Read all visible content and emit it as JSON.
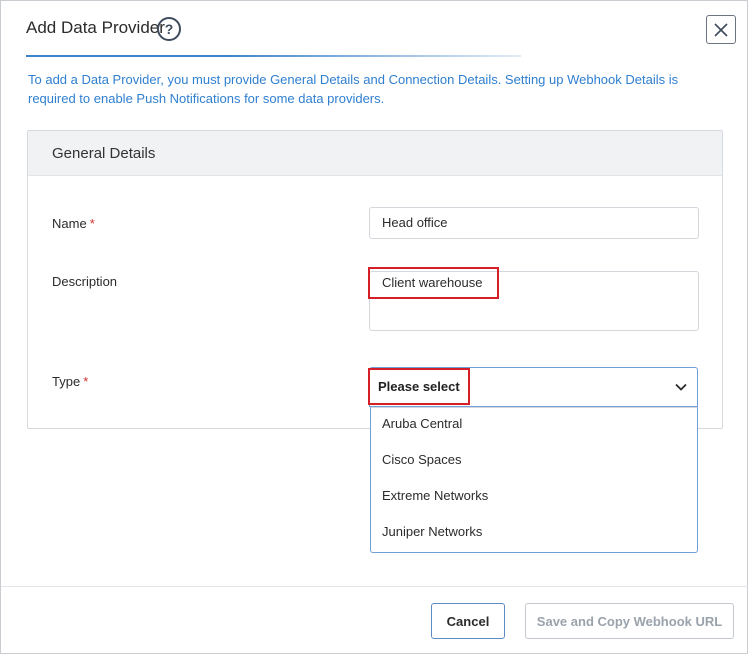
{
  "dialog": {
    "title": "Add Data Provider",
    "help_icon": "question-icon",
    "close_icon": "close-icon",
    "intro": "To add a Data Provider, you must provide General Details and Connection Details. Setting up Webhook Details is required to enable Push Notifications for some data providers."
  },
  "panel": {
    "header": "General Details",
    "fields": {
      "name_label": "Name",
      "name_value": "Head office",
      "description_label": "Description",
      "description_value": "Client warehouse",
      "type_label": "Type",
      "type_value": "Please select",
      "required_mark": "*"
    },
    "type_options": [
      "Aruba Central",
      "Cisco Spaces",
      "Extreme Networks",
      "Juniper Networks"
    ]
  },
  "footer": {
    "cancel_label": "Cancel",
    "save_label": "Save and Copy Webhook URL"
  },
  "colors": {
    "accent": "#2f7fd0",
    "highlight": "#d41f26",
    "required": "#d0312d",
    "disabled_text": "#9aa2ab"
  }
}
